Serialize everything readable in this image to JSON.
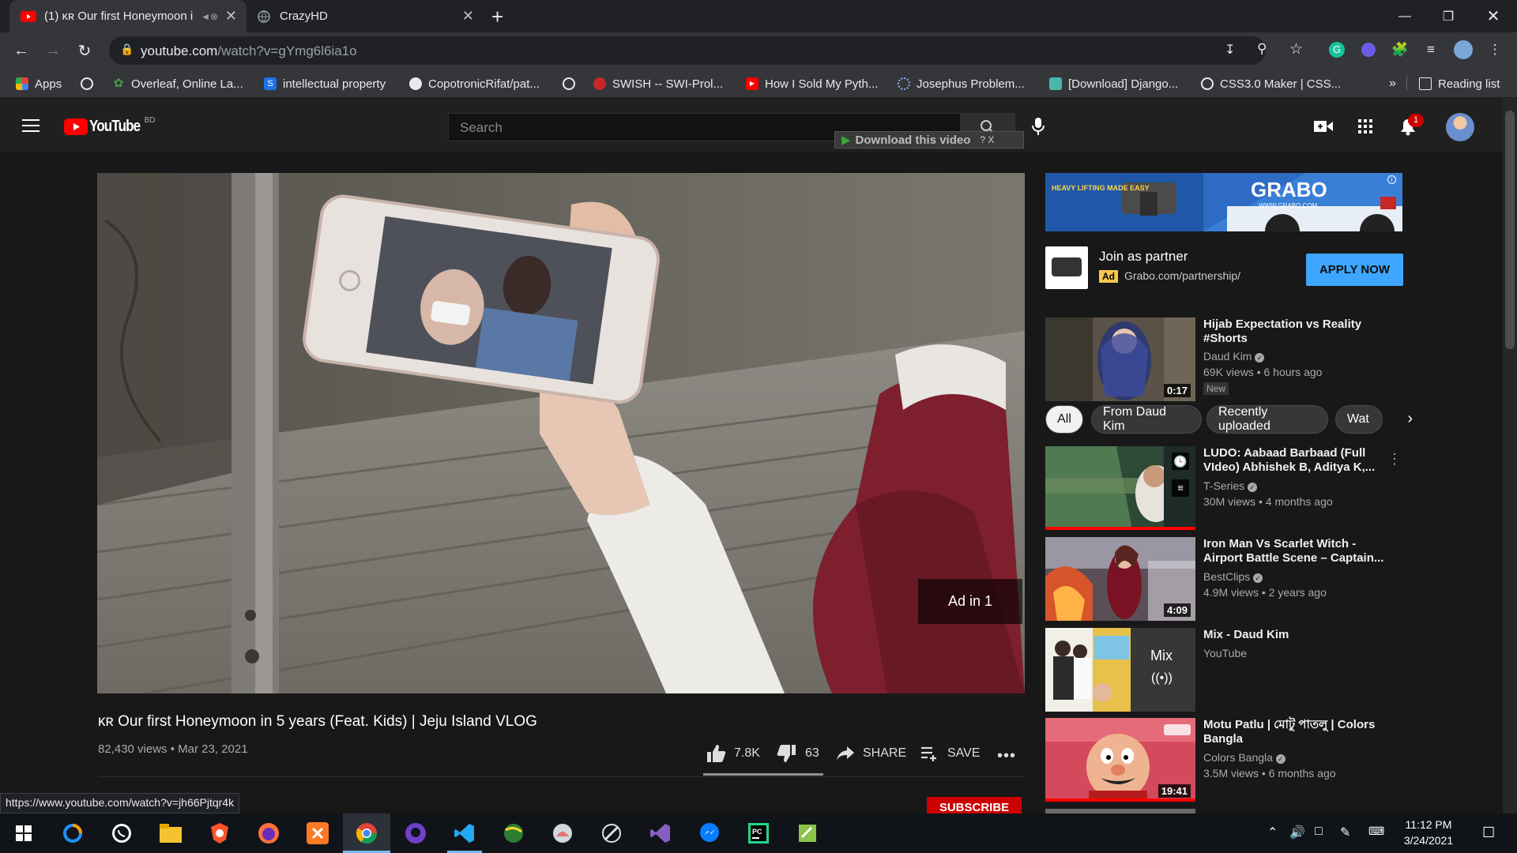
{
  "browser": {
    "tabs": [
      {
        "title": "(1) ᴋʀ Our first Honeymoon i",
        "active": true
      },
      {
        "title": "CrazyHD",
        "active": false
      }
    ],
    "new_tab": "+",
    "url_host": "youtube.com",
    "url_path": "/watch?v=gYmg6l6ia1o",
    "bookmarks": [
      {
        "label": "Apps",
        "icon": "apps-grid-icon"
      },
      {
        "label": "",
        "icon": "globe-icon"
      },
      {
        "label": "Overleaf, Online La...",
        "icon": "overleaf-icon"
      },
      {
        "label": "intellectual property",
        "icon": "s-icon"
      },
      {
        "label": "CopotronicRifat/pat...",
        "icon": "github-icon"
      },
      {
        "label": "",
        "icon": "globe-icon"
      },
      {
        "label": "SWISH -- SWI-Prol...",
        "icon": "swish-icon"
      },
      {
        "label": "How I Sold My Pyth...",
        "icon": "youtube-icon"
      },
      {
        "label": "Josephus Problem...",
        "icon": "loading-icon"
      },
      {
        "label": "[Download] Django...",
        "icon": "image-icon"
      },
      {
        "label": "CSS3.0 Maker | CSS...",
        "icon": "globe-icon"
      }
    ],
    "more_bookmarks": "»",
    "reading_list": "Reading list",
    "status_url": "https://www.youtube.com/watch?v=jh66Pjtqr4k"
  },
  "youtube": {
    "logo_text": "YouTube",
    "region": "BD",
    "search_placeholder": "Search",
    "download_bar": "Download this video",
    "download_bar_extra": "? X",
    "notification_count": "1",
    "ad_overlay": "Ad in 1",
    "video": {
      "title": "ᴋʀ Our first Honeymoon in 5 years (Feat. Kids) | Jeju Island VLOG",
      "views": "82,430 views",
      "date": "Mar 23, 2021",
      "likes": "7.8K",
      "dislikes": "63",
      "share": "SHARE",
      "save": "SAVE",
      "like_ratio": 0.992
    },
    "subscribe": "SUBSCRIBE",
    "sidebar_ad": {
      "banner_brand": "GRABO",
      "banner_tagline": "HEAVY LIFTING MADE EASY",
      "banner_site": "WWW.GRABO.COM",
      "title": "Join as partner",
      "badge": "Ad",
      "url": "Grabo.com/partnership/",
      "cta": "APPLY NOW"
    },
    "chips": [
      "All",
      "From Daud Kim",
      "Recently uploaded",
      "Wat"
    ],
    "recommendations": [
      {
        "title": "Hijab Expectation vs Reality #Shorts",
        "channel": "Daud Kim",
        "verified": true,
        "meta": "69K views • 6 hours ago",
        "badge": "New",
        "duration": "0:17"
      },
      {
        "title": "LUDO: Aabaad Barbaad (Full VIdeo) Abhishek B, Aditya K,...",
        "channel": "T-Series",
        "verified": true,
        "meta": "30M views • 4 months ago",
        "duration": "",
        "progress": 1.0
      },
      {
        "title": "Iron Man Vs Scarlet Witch - Airport Battle Scene – Captain...",
        "channel": "BestClips",
        "verified": true,
        "meta": "4.9M views • 2 years ago",
        "duration": "4:09"
      },
      {
        "title": "Mix - Daud Kim",
        "channel": "YouTube",
        "verified": false,
        "meta": "",
        "mix_label": "Mix",
        "duration": ""
      },
      {
        "title": "Motu Patlu | মোটু পাতলু | Colors Bangla",
        "channel": "Colors Bangla",
        "verified": true,
        "meta": "3.5M views • 6 months ago",
        "duration": "19:41",
        "progress": 1.0
      }
    ]
  },
  "taskbar": {
    "time": "11:12 PM",
    "date": "3/24/2021",
    "apps": [
      "windows-start-icon",
      "search-app-icon",
      "whatsapp-icon",
      "file-explorer-icon",
      "brave-icon",
      "firefox-icon",
      "xampp-icon",
      "chrome-icon",
      "github-desktop-icon",
      "vscode-icon",
      "earth-icon",
      "app-icon",
      "app-icon-2",
      "visual-studio-icon",
      "messenger-icon",
      "pycharm-icon",
      "notepad-icon"
    ]
  },
  "colors": {
    "yt_red": "#ff0000",
    "accent_blue": "#3ea6ff",
    "page_bg": "#181818"
  }
}
